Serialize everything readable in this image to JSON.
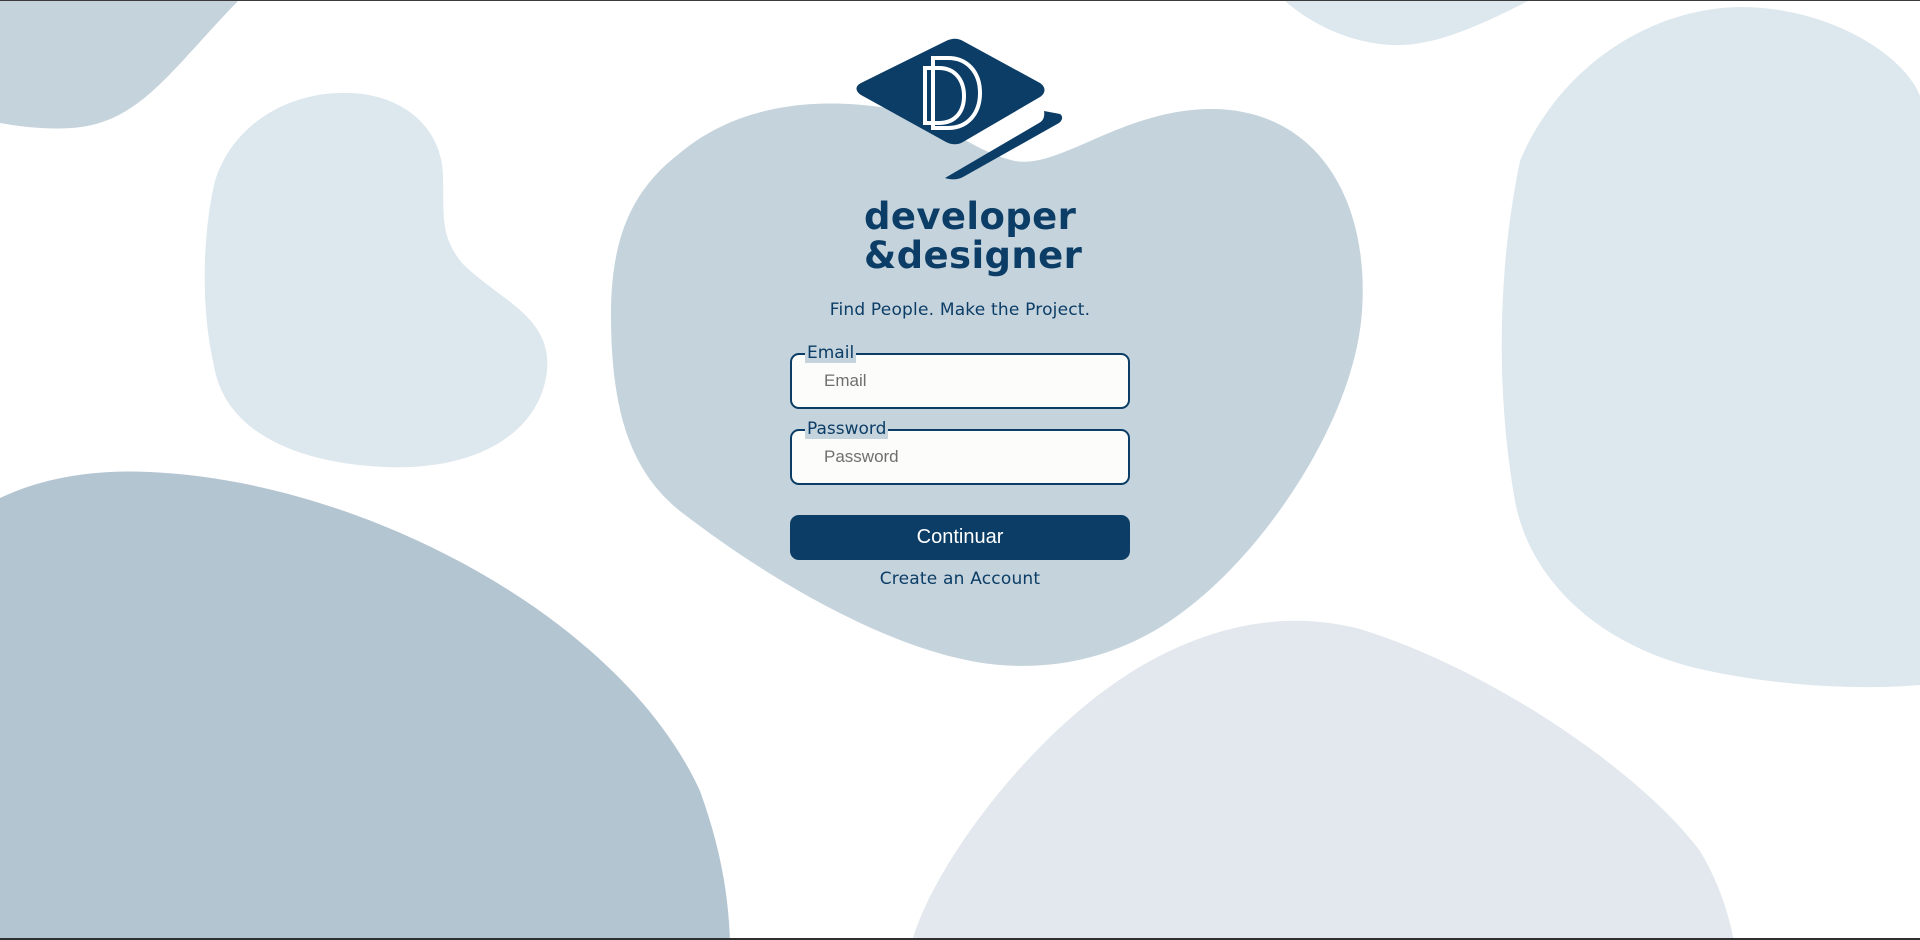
{
  "brand": {
    "line1": "developer",
    "line2": "&designer",
    "logo_icon": "dd-monogram-diamond-icon",
    "color": "#0b3d66"
  },
  "tagline": "Find People. Make the Project.",
  "form": {
    "email": {
      "label": "Email",
      "placeholder": "Email",
      "value": ""
    },
    "password": {
      "label": "Password",
      "placeholder": "Password",
      "value": ""
    },
    "submit_label": "Continuar",
    "create_account_label": "Create an Account"
  },
  "colors": {
    "primary": "#0b3d66",
    "blob_light": "#dde7ee",
    "blob_mid": "#c5d3dc",
    "blob_dark": "#b4c5d2",
    "input_bg": "#fcfcfa"
  }
}
